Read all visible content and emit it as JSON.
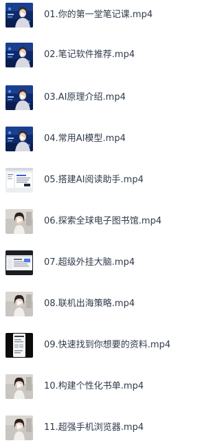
{
  "files": [
    {
      "name": "01.你的第一堂笔记课.mp4",
      "thumbnail": "presenter-blue-stage-thumbnail"
    },
    {
      "name": "02.笔记软件推荐.mp4",
      "thumbnail": "presenter-blue-stage-thumbnail"
    },
    {
      "name": "03.AI原理介绍.mp4",
      "thumbnail": "presenter-blue-stage-thumbnail"
    },
    {
      "name": "04.常用AI模型.mp4",
      "thumbnail": "presenter-blue-stage-thumbnail"
    },
    {
      "name": "05.搭建AI阅读助手.mp4",
      "thumbnail": "software-screen-thumbnail"
    },
    {
      "name": "06.探索全球电子图书馆.mp4",
      "thumbnail": "presenter-grey-room-thumbnail"
    },
    {
      "name": "07.超级外挂大脑.mp4",
      "thumbnail": "app-window-thumbnail"
    },
    {
      "name": "08.联机出海策略.mp4",
      "thumbnail": "presenter-grey-room-thumbnail"
    },
    {
      "name": "09.快速找到你想要的资料.mp4",
      "thumbnail": "phone-screen-thumbnail"
    },
    {
      "name": "10.构建个性化书单.mp4",
      "thumbnail": "presenter-grey-room-thumbnail"
    },
    {
      "name": "11.超强手机浏览器.mp4",
      "thumbnail": "presenter-grey-room-thumbnail"
    }
  ]
}
